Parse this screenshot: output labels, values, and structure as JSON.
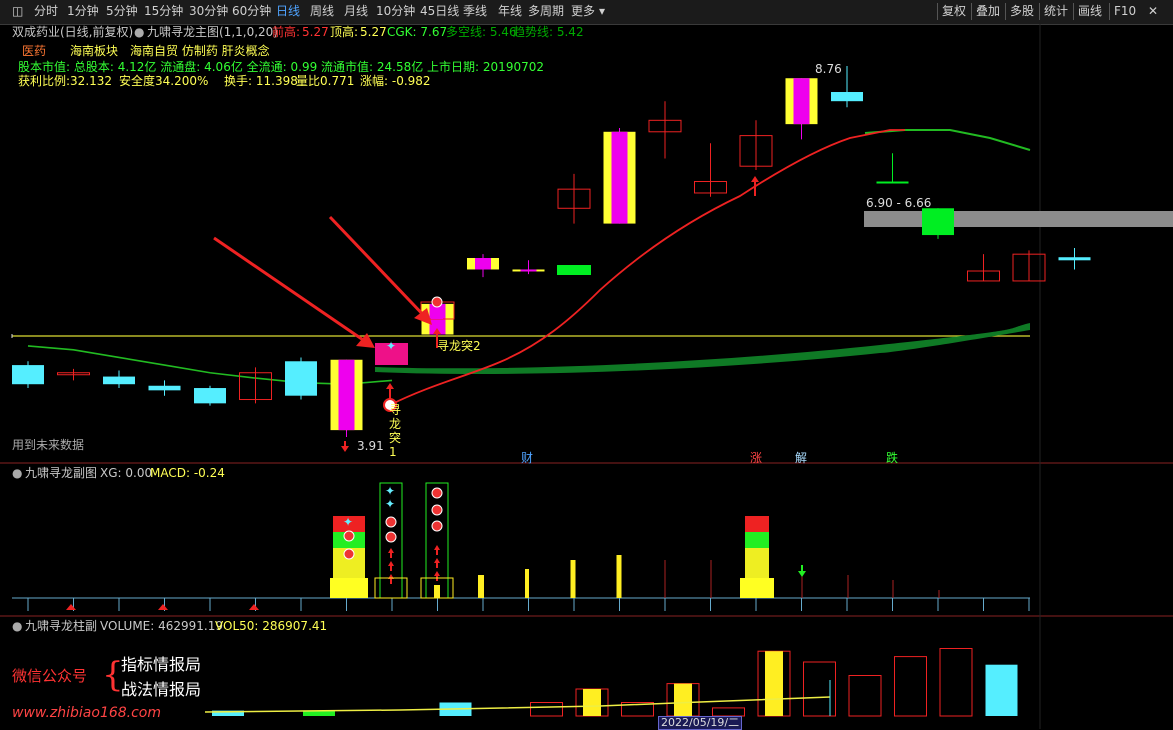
{
  "toolbar": {
    "menu_icon": "window-menu-icon",
    "periods": [
      "分时",
      "1分钟",
      "5分钟",
      "15分钟",
      "30分钟",
      "60分钟",
      "日线",
      "周线",
      "月线",
      "10分钟",
      "45日线",
      "季线",
      "年线",
      "多周期",
      "更多"
    ],
    "active_period": "日线",
    "right_buttons": [
      "复权",
      "叠加",
      "多股",
      "统计",
      "画线",
      "F10"
    ],
    "more_arrow": "chevron-down-icon",
    "close_icon": "close-icon"
  },
  "stock_info": {
    "name_line": "双成药业(日线,前复权)",
    "indicator": "九啸寻龙主图(1,1,0,20)",
    "prev_high_label": "前高:",
    "prev_high": "5.27",
    "top_high_label": "顶高:",
    "top_high": "5.27",
    "cgk": "CGK: 7.67",
    "duokong": "多空线: 5.46",
    "trend": "趋势线: 5.42",
    "sector": "医药",
    "concepts": "海南板块　海南自贸 仿制药 肝炎概念",
    "capital_line": "股本市值: 总股本: 4.12亿 流通盘: 4.06亿 全流通: 0.99 流通市值: 24.58亿 上市日期: 20190702",
    "profit_ratio": "获利比例:32.132",
    "safety": "安全度34.200%",
    "turnover": "换手: 11.398",
    "vol_ratio": "量比0.771",
    "change": "涨幅: -0.982"
  },
  "main_chart": {
    "high_label": "8.76",
    "low_label": "3.91",
    "range_label": "6.90 - 6.66",
    "future_data_note": "用到未来数据",
    "signal1": "寻龙突1",
    "signal2": "寻龙突2",
    "event_marks": [
      "财",
      "涨",
      "解",
      "跌"
    ],
    "candles": [
      {
        "o": 4.6,
        "c": 4.85,
        "h": 4.9,
        "l": 4.55,
        "color": "cyan"
      },
      {
        "o": 4.75,
        "c": 4.75,
        "h": 4.8,
        "l": 4.65,
        "color": "red"
      },
      {
        "o": 4.7,
        "c": 4.6,
        "h": 4.78,
        "l": 4.55,
        "color": "cyan"
      },
      {
        "o": 4.58,
        "c": 4.52,
        "h": 4.65,
        "l": 4.45,
        "color": "cyan"
      },
      {
        "o": 4.55,
        "c": 4.35,
        "h": 4.58,
        "l": 4.32,
        "color": "cyan"
      },
      {
        "o": 4.4,
        "c": 4.75,
        "h": 4.82,
        "l": 4.35,
        "color": "red"
      },
      {
        "o": 4.45,
        "c": 4.9,
        "h": 4.95,
        "l": 4.4,
        "color": "cyan"
      },
      {
        "o": 4.0,
        "c": 4.92,
        "h": 4.92,
        "l": 3.91,
        "color": "magenta"
      },
      {
        "o": null,
        "c": null,
        "h": null,
        "l": null,
        "color": "none"
      },
      {
        "o": 5.25,
        "c": 5.65,
        "h": 5.7,
        "l": 5.2,
        "color": "magenta"
      },
      {
        "o": 6.1,
        "c": 6.25,
        "h": 6.3,
        "l": 6.0,
        "color": "magenta"
      },
      {
        "o": 6.1,
        "c": 6.1,
        "h": 6.22,
        "l": 6.04,
        "color": "magenta"
      },
      {
        "o": 6.9,
        "c": 7.15,
        "h": 7.35,
        "l": 6.7,
        "color": "red"
      },
      {
        "o": 6.7,
        "c": 7.9,
        "h": 7.95,
        "l": 6.7,
        "color": "magenta"
      },
      {
        "o": 7.9,
        "c": 8.05,
        "h": 8.3,
        "l": 7.55,
        "color": "red"
      },
      {
        "o": 7.1,
        "c": 7.25,
        "h": 7.75,
        "l": 7.05,
        "color": "red"
      },
      {
        "o": 7.45,
        "c": 7.85,
        "h": 8.05,
        "l": 7.4,
        "color": "red"
      },
      {
        "o": 8.0,
        "c": 8.6,
        "h": 8.6,
        "l": 7.8,
        "color": "magenta"
      },
      {
        "o": 8.42,
        "c": 8.3,
        "h": 8.76,
        "l": 8.22,
        "color": "cyan"
      },
      {
        "o": 7.25,
        "c": 7.25,
        "h": 7.62,
        "l": 7.25,
        "color": "green"
      },
      {
        "o": 6.9,
        "c": 6.55,
        "h": 6.9,
        "l": 6.5,
        "color": "green"
      },
      {
        "o": 6.08,
        "c": 5.95,
        "h": 6.3,
        "l": 5.95,
        "color": "red"
      },
      {
        "o": 5.95,
        "c": 6.3,
        "h": 6.35,
        "l": 5.95,
        "color": "red"
      },
      {
        "o": 6.22,
        "c": 6.26,
        "h": 6.38,
        "l": 6.1,
        "color": "cyan"
      }
    ],
    "red_line": [
      null,
      null,
      null,
      null,
      null,
      null,
      null,
      null,
      4.65,
      4.75,
      4.95,
      5.25,
      5.6,
      6.0,
      6.45,
      6.85,
      7.25,
      7.65,
      8.05,
      8.35,
      8.45
    ],
    "green_line": [
      5.1,
      5.05,
      4.95,
      4.85,
      4.75,
      4.68,
      4.62,
      4.6,
      4.65
    ]
  },
  "sub_chart": {
    "title": "九啸寻龙副图",
    "xg": "XG: 0.00",
    "macd": "MACD: -0.24"
  },
  "vol_chart": {
    "title": "九啸寻龙柱副",
    "volume": "VOLUME: 462991.19",
    "vol50": "VOL50: 286907.41",
    "date_label": "2022/05/19/二",
    "bars": [
      {
        "v": 2,
        "color": "cyan"
      },
      {
        "v": 0,
        "color": "none"
      },
      {
        "v": 2,
        "color": "green"
      },
      {
        "v": 0,
        "color": "none"
      },
      {
        "v": 0,
        "color": "none"
      },
      {
        "v": 5,
        "color": "cyan"
      },
      {
        "v": 0,
        "color": "none"
      },
      {
        "v": 5,
        "color": "red"
      },
      {
        "v": 10,
        "color": "yellow"
      },
      {
        "v": 5,
        "color": "red"
      },
      {
        "v": 12,
        "color": "yellow"
      },
      {
        "v": 3,
        "color": "red"
      },
      {
        "v": 24,
        "color": "yellow"
      },
      {
        "v": 20,
        "color": "red"
      },
      {
        "v": 15,
        "color": "red"
      },
      {
        "v": 22,
        "color": "red"
      },
      {
        "v": 25,
        "color": "red"
      },
      {
        "v": 19,
        "color": "cyan"
      }
    ]
  },
  "watermark": {
    "wechat": "微信公众号",
    "line1": "指标情报局",
    "line2": "战法情报局",
    "url": "www.zhibiao168.com"
  }
}
